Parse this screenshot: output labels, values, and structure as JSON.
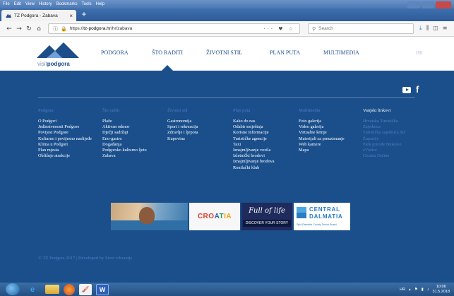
{
  "browser": {
    "menu": [
      "File",
      "Edit",
      "View",
      "History",
      "Bookmarks",
      "Tools",
      "Help"
    ],
    "tab_title": "TZ Podgora - Zabava",
    "tab_close": "×",
    "new_tab": "+",
    "url_prefix": "https://",
    "url_host": "tz-podgora.hr",
    "url_path": "/hr/zabava",
    "url_tools": "··· ♥ ☆",
    "search_placeholder": "Search"
  },
  "site": {
    "logo_prefix": "visit",
    "logo_name": "podgora",
    "nav": [
      "PODGORA",
      "ŠTO RADITI",
      "ŽIVOTNI STIL",
      "PLAN PUTA",
      "MULTIMEDIA"
    ],
    "active_nav_index": 1,
    "lang": "HR",
    "footer": {
      "columns": [
        {
          "head": "Podgora",
          "links": [
            "O Podgori",
            "Jedinstvenosti Podgore",
            "Povijest Podgore",
            "Kulturno i povijesno naslijeđe",
            "Klima u Podgori",
            "Plan mjesta",
            "Obližnje atrakcije"
          ]
        },
        {
          "head": "Što raditi",
          "links": [
            "Plaže",
            "Aktivan odmor",
            "Dječji sadržaji",
            "Eno-gastro",
            "Događanja",
            "Podgorsko kulturno ljeto",
            "Zabava"
          ]
        },
        {
          "head": "Životni stil",
          "links": [
            "Gastronomija",
            "Sport i rekreacija",
            "Zdravlje i ljepota",
            "Kupovina"
          ]
        },
        {
          "head": "Plan puta",
          "links": [
            "Kako do nas",
            "Odabir smještaja",
            "Korisne informacije",
            "Turističke agencije",
            "Taxi",
            "Iznajmljivanje vozila",
            "Izletnički brodovi",
            "Iznajmljivanje brodova",
            "Ronilački klub"
          ]
        },
        {
          "head": "Multimedia",
          "links": [
            "Foto galerija",
            "Video galerija",
            "Virtualne šetnje",
            "Materijali za preuzimanje",
            "Web kamere",
            "Mapa"
          ]
        },
        {
          "head": "Vanjski linkovi",
          "links": [
            "Hrvatska Turistička",
            "Zajednica",
            "Turistička zajednica SD",
            "Županije",
            "Park prirode Biokovo",
            "eVisitor",
            "Croatia Online"
          ]
        }
      ],
      "copyright": "© TZ Podgora 2017 | Developed by Siver vibrantje"
    },
    "banners": {
      "croatia": [
        "CRO",
        "A",
        "T",
        "IA"
      ],
      "fulloflife": "Full of life",
      "discover": "DISCOVER YOUR STORY",
      "central": "CENTRAL",
      "dalmatia": "DALMATIA",
      "split_board": "Split Dalmatia County Tourist Board"
    }
  },
  "taskbar": {
    "ie": "e",
    "paint": "🖌",
    "word": "W",
    "lang": "HR",
    "time": "10:06",
    "date": "31.5.2018"
  },
  "colors": {
    "footer_bg": "#1a4f8c",
    "nav_text": "#1d4e8a",
    "footer_head": "#4d7fc4"
  }
}
